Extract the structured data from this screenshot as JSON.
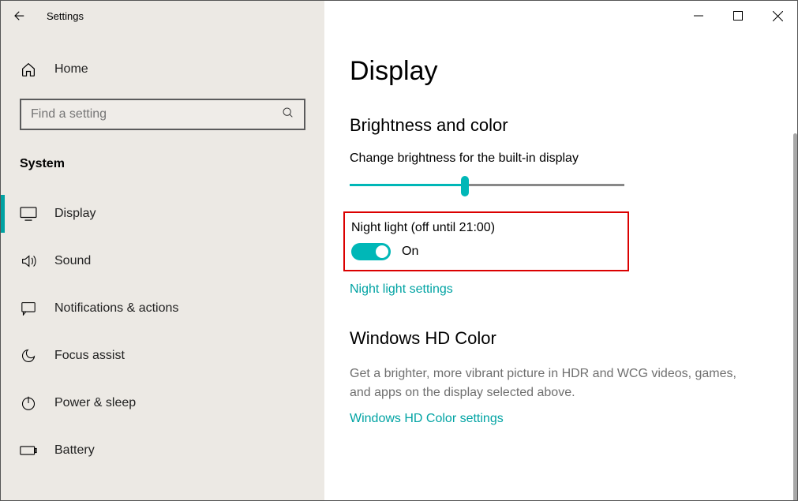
{
  "window": {
    "title": "Settings"
  },
  "sidebar": {
    "home_label": "Home",
    "search_placeholder": "Find a setting",
    "category": "System",
    "items": [
      {
        "label": "Display",
        "icon": "display-icon",
        "active": true
      },
      {
        "label": "Sound",
        "icon": "sound-icon"
      },
      {
        "label": "Notifications & actions",
        "icon": "notifications-icon"
      },
      {
        "label": "Focus assist",
        "icon": "focus-icon"
      },
      {
        "label": "Power & sleep",
        "icon": "power-icon"
      },
      {
        "label": "Battery",
        "icon": "battery-icon"
      }
    ]
  },
  "content": {
    "page_title": "Display",
    "brightness": {
      "header": "Brightness and color",
      "slider_label": "Change brightness for the built-in display",
      "slider_value_pct": 42,
      "night_light_label": "Night light (off until 21:00)",
      "night_light_state": "On",
      "night_light_link": "Night light settings"
    },
    "hd_color": {
      "header": "Windows HD Color",
      "description": "Get a brighter, more vibrant picture in HDR and WCG videos, games, and apps on the display selected above.",
      "link": "Windows HD Color settings"
    }
  }
}
